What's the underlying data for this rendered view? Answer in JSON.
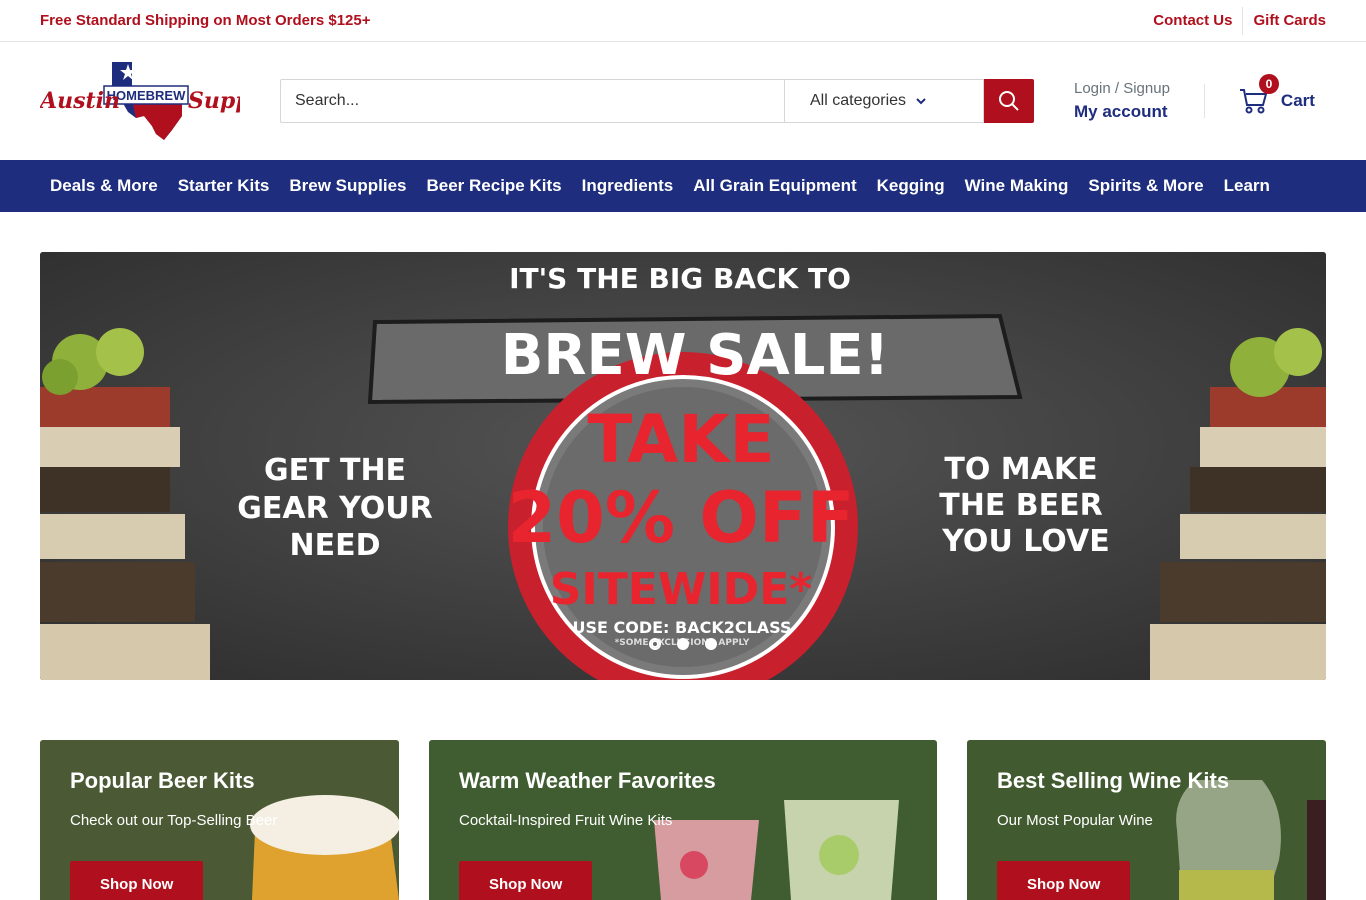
{
  "topbar": {
    "promo": "Free Standard Shipping on Most Orders $125+",
    "links": [
      "Contact Us",
      "Gift Cards"
    ]
  },
  "logo": {
    "word1": "Austin",
    "word2": "HOMEBREW",
    "word3": "Supply"
  },
  "search": {
    "placeholder": "Search...",
    "category": "All categories"
  },
  "account": {
    "login": "Login / Signup",
    "my_account": "My account"
  },
  "cart": {
    "count": "0",
    "label": "Cart"
  },
  "nav": [
    "Deals & More",
    "Starter Kits",
    "Brew Supplies",
    "Beer Recipe Kits",
    "Ingredients",
    "All Grain Equipment",
    "Kegging",
    "Wine Making",
    "Spirits & More",
    "Learn"
  ],
  "hero": {
    "line1": "IT'S THE BIG BACK TO",
    "line2": "BREW SALE!",
    "left": [
      "GET THE",
      "GEAR YOUR",
      "NEED"
    ],
    "center": [
      "TAKE",
      "20% OFF",
      "SITEWIDE*"
    ],
    "code": "USE CODE: BACK2CLASS",
    "fine": "*SOME EXCLUSIONS APPLY",
    "right": [
      "TO MAKE",
      "THE BEER",
      "YOU LOVE"
    ],
    "slides": 3,
    "active_slide": 1
  },
  "cards": [
    {
      "title": "Popular Beer Kits",
      "subtitle": "Check out our Top-Selling Beer",
      "button": "Shop Now"
    },
    {
      "title": "Warm Weather Favorites",
      "subtitle": "Cocktail-Inspired Fruit Wine Kits",
      "button": "Shop Now"
    },
    {
      "title": "Best Selling Wine Kits",
      "subtitle": "Our Most Popular Wine",
      "button": "Shop Now"
    }
  ],
  "colors": {
    "brand_blue": "#1e2d7d",
    "brand_red": "#b0101d"
  }
}
